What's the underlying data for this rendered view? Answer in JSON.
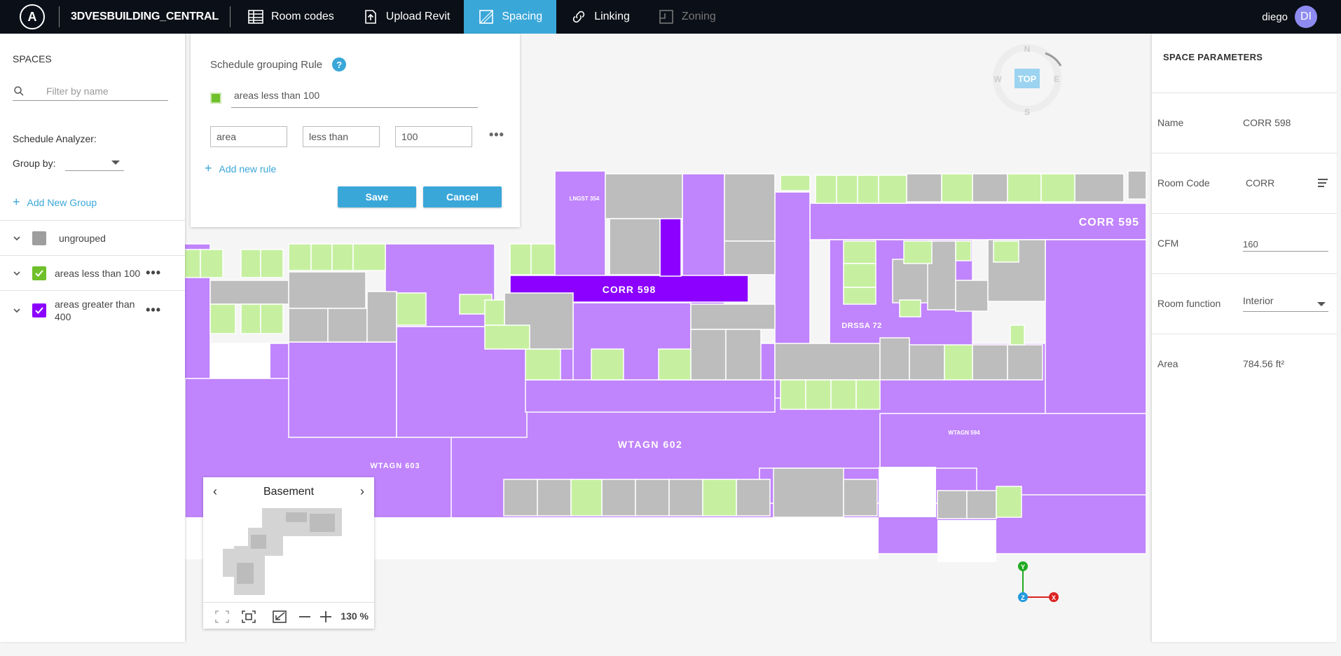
{
  "topbar": {
    "logo": "A",
    "project": "3DVESBUILDING_CENTRAL",
    "tabs": [
      {
        "label": "Room codes",
        "icon": "table-icon"
      },
      {
        "label": "Upload Revit",
        "icon": "upload-icon"
      },
      {
        "label": "Spacing",
        "icon": "spacing-icon"
      },
      {
        "label": "Linking",
        "icon": "link-icon"
      },
      {
        "label": "Zoning",
        "icon": "zoning-icon"
      }
    ],
    "active_tab": "Spacing",
    "user": "diego",
    "avatar": "DI"
  },
  "left": {
    "title": "SPACES",
    "search_placeholder": "Filter by name",
    "analyzer_label": "Schedule Analyzer:",
    "groupby_label": "Group by:",
    "add_group": "Add New Group",
    "groups": [
      {
        "name": "ungrouped",
        "color": "#9e9e9e"
      },
      {
        "name": "areas less than 100",
        "color": "#6fc02a",
        "checked": true
      },
      {
        "name": "areas greater than 400",
        "color": "#8b00ff",
        "checked": true
      }
    ]
  },
  "rule": {
    "title": "Schedule grouping Rule",
    "help": "?",
    "name": "areas less than 100",
    "field": "area",
    "operator": "less than",
    "value": "100",
    "add_rule": "Add new rule",
    "save": "Save",
    "cancel": "Cancel"
  },
  "map": {
    "labels": {
      "corr598": "CORR 598",
      "corr595": "CORR 595",
      "wtagn602": "WTAGN 602",
      "wtagn603": "WTAGN 603",
      "drssa72": "DRSSA 72",
      "lngst354": "LNGST 354",
      "wtagn594": "WTAGN 594"
    },
    "colors": {
      "purple": "#c084fc",
      "selected": "#8b00ff",
      "gray": "#bdbdbd",
      "green": "#c6f0a0"
    }
  },
  "compass": {
    "n": "N",
    "s": "S",
    "e": "E",
    "w": "W",
    "top": "TOP"
  },
  "axes": {
    "x": "X",
    "y": "Y",
    "z": "Z"
  },
  "minimap": {
    "title": "Basement",
    "zoom": "130 %"
  },
  "right": {
    "title": "SPACE PARAMETERS",
    "name_label": "Name",
    "name_value": "CORR 598",
    "code_label": "Room Code",
    "code_value": "CORR",
    "cfm_label": "CFM",
    "cfm_value": "160",
    "function_label": "Room function",
    "function_value": "Interior",
    "area_label": "Area",
    "area_value": "784.56 ft²"
  }
}
